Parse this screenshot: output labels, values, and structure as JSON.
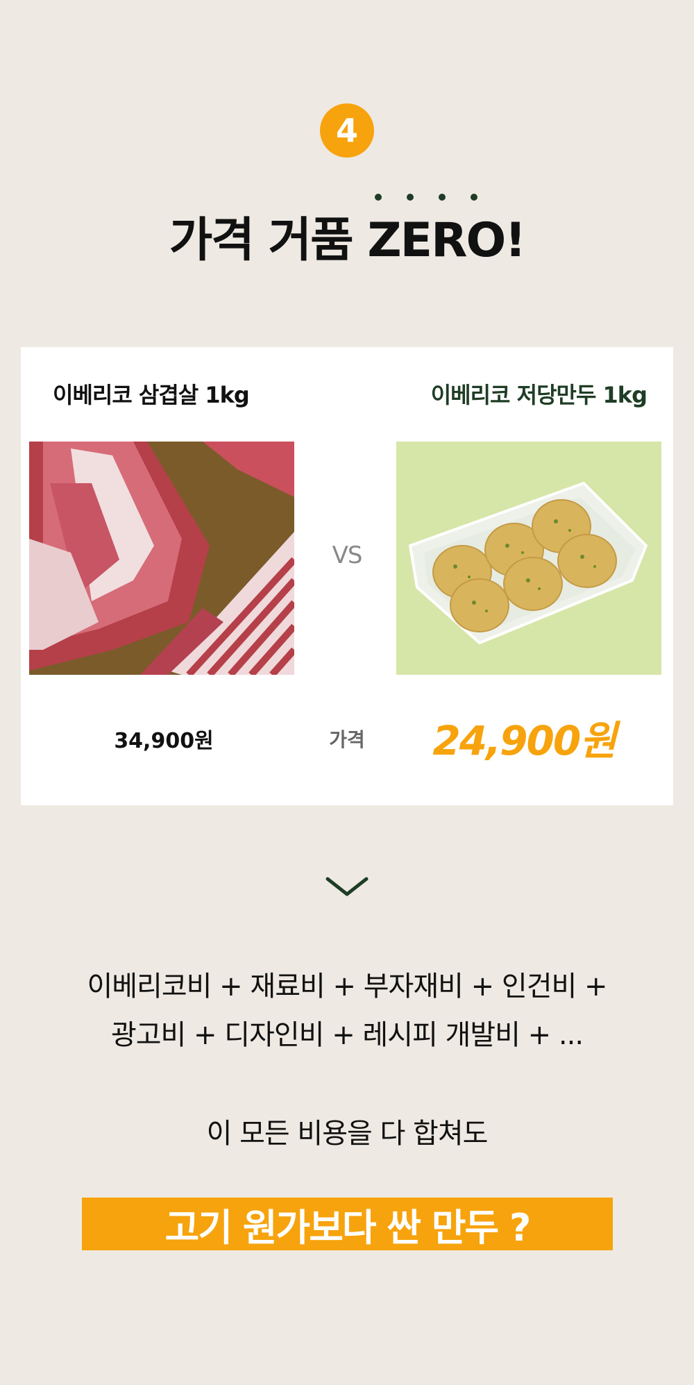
{
  "step": {
    "number": "4"
  },
  "headline": "가격 거품 ZERO!",
  "comparison": {
    "left_title": "이베리코 삼겹살 1kg",
    "right_title": "이베리코 저당만두 1kg",
    "vs_label": "VS",
    "left_price": "34,900원",
    "price_label": "가격",
    "right_price": "24,900원"
  },
  "cost_lines": [
    "이베리코비 + 재료비 + 부자재비 + 인건비 +",
    "광고비 + 디자인비 + 레시피 개발비 + ..."
  ],
  "summary_line": "이 모든 비용을 다 합쳐도",
  "banner_text": "고기 원가보다 싼 만두 ?",
  "colors": {
    "background": "#eee9e3",
    "accent_orange": "#f7a30d",
    "dark_green": "#1f3d24"
  }
}
